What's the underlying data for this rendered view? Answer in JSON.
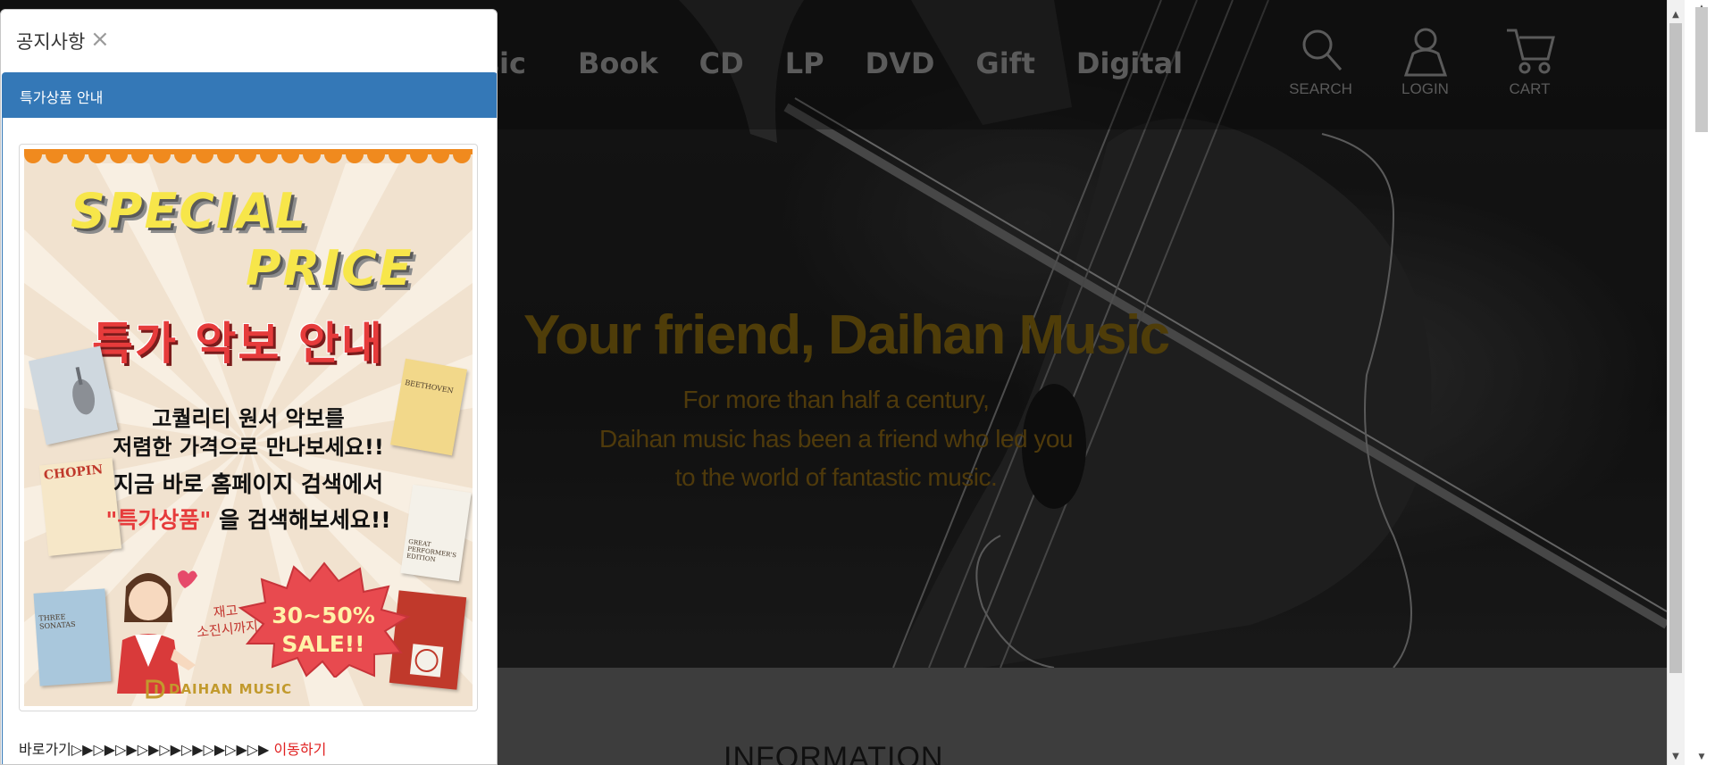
{
  "nav": {
    "partial_item": "sic",
    "items": [
      "Book",
      "CD",
      "LP",
      "DVD",
      "Gift",
      "Digital"
    ]
  },
  "utils": [
    {
      "icon": "search-icon",
      "label": "SEARCH"
    },
    {
      "icon": "user-icon",
      "label": "LOGIN"
    },
    {
      "icon": "cart-icon",
      "label": "CART"
    }
  ],
  "hero": {
    "title": "Your friend, Daihan Music",
    "line1": "For more than half a century,",
    "line2": "Daihan music has been a friend who led you",
    "line3": "to the world of fantastic music."
  },
  "info": {
    "title": "INFORMATION"
  },
  "popup": {
    "title": "공지사항",
    "close_glyph": "×",
    "panel_title": "특가상품 안내",
    "banner": {
      "special": "SPECIAL",
      "price": "PRICE",
      "headline": "특가 악보 안내",
      "line1": "고퀄리티 원서 악보를",
      "line2": "저렴한 가격으로 만나보세요!!",
      "line3": "지금 바로 홈페이지 검색에서",
      "line4_highlight": "\"특가상품\"",
      "line4_rest": " 을 검색해보세요!!",
      "stock_line1": "재고",
      "stock_line2": "소진시까지",
      "sale_line1": "30~50%",
      "sale_line2": "SALE!!",
      "brand": "DAIHAN MUSIC",
      "books": [
        "CHOPIN",
        "BEETHOVEN",
        "THREE SONATAS",
        "GREAT PERFORMER'S EDITION"
      ]
    },
    "shortcut_prefix": "바로가기▷▶▷▶▷▶▷▶▷▶▷▶▷▶▷▶▷▶ ",
    "shortcut_link": "이동하기"
  },
  "colors": {
    "panel_header": "#3478b7",
    "hero_title": "#7a5e0e",
    "link_red": "#e02020"
  }
}
